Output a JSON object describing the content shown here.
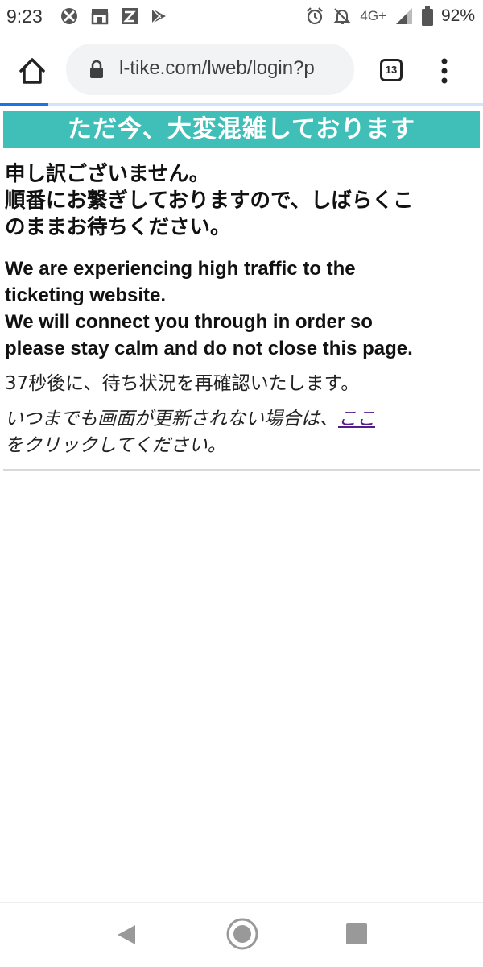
{
  "status_bar": {
    "time": "9:23",
    "network": "4G+",
    "battery": "92%",
    "notification_icons": [
      "xbox-icon",
      "store-icon",
      "app-icon",
      "play-store-icon"
    ],
    "system_icons": [
      "alarm-icon",
      "mute-icon",
      "signal-icon",
      "battery-icon"
    ]
  },
  "browser": {
    "url": "l-tike.com/lweb/login?p",
    "tab_count": "13",
    "load_progress": 0.1
  },
  "page": {
    "banner": "ただ今、大変混雑しております",
    "apology_ja": [
      "申し訳ございません。",
      "順番にお繋ぎしておりますので、しばらくこ",
      "のままお待ちください。"
    ],
    "apology_en": [
      "We are experiencing high traffic to the",
      "ticketing website.",
      "We will connect you through in order so",
      "please stay calm and do not close this page."
    ],
    "countdown": "37秒後に、待ち状況を再確認いたします。",
    "refresh_note_before": "いつまでも画面が更新されない場合は、",
    "refresh_link": "ここ",
    "refresh_note_after": "をクリックしてください。"
  },
  "colors": {
    "banner_bg": "#3fbfb8",
    "link": "#551a8b",
    "progress": "#1a73e8"
  }
}
